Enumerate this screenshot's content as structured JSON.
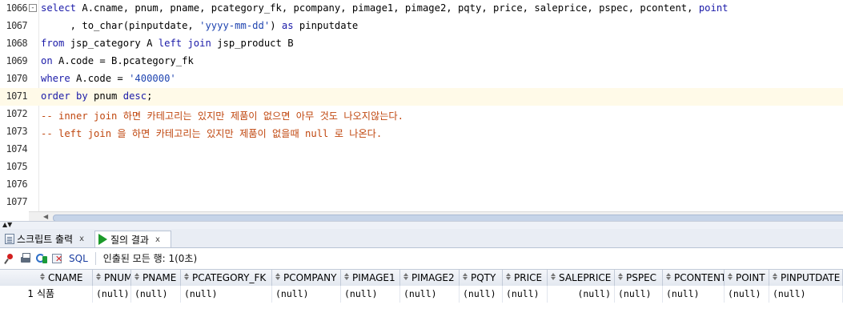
{
  "editor": {
    "lines": [
      {
        "num": "1066",
        "fold": "-",
        "segments": [
          {
            "t": "select",
            "c": "kw"
          },
          {
            "t": " A.cname, pnum, pname, pcategory_fk, pcompany, pimage1, pimage2, pqty, price, saleprice, pspec, pcontent, ",
            "c": ""
          },
          {
            "t": "point",
            "c": "kw"
          }
        ]
      },
      {
        "num": "1067",
        "segments": [
          {
            "t": "     , to_char(pinputdate, ",
            "c": ""
          },
          {
            "t": "'yyyy-mm-dd'",
            "c": "str"
          },
          {
            "t": ") ",
            "c": ""
          },
          {
            "t": "as",
            "c": "kw"
          },
          {
            "t": " pinputdate",
            "c": ""
          }
        ]
      },
      {
        "num": "1068",
        "segments": [
          {
            "t": "from",
            "c": "kw"
          },
          {
            "t": " jsp_category A ",
            "c": ""
          },
          {
            "t": "left join",
            "c": "kw"
          },
          {
            "t": " jsp_product B",
            "c": ""
          }
        ]
      },
      {
        "num": "1069",
        "segments": [
          {
            "t": "on",
            "c": "kw"
          },
          {
            "t": " A.code = B.pcategory_fk",
            "c": ""
          }
        ]
      },
      {
        "num": "1070",
        "segments": [
          {
            "t": "where",
            "c": "kw"
          },
          {
            "t": " A.code = ",
            "c": ""
          },
          {
            "t": "'400000'",
            "c": "str"
          }
        ]
      },
      {
        "num": "1071",
        "highlight": true,
        "segments": [
          {
            "t": "order by",
            "c": "kw"
          },
          {
            "t": " pnum ",
            "c": ""
          },
          {
            "t": "desc",
            "c": "kw"
          },
          {
            "t": ";",
            "c": ""
          }
        ]
      },
      {
        "num": "1072",
        "segments": [
          {
            "t": "-- inner join 하면 카테고리는 있지만 제품이 없으면 아무 것도 나오지않는다.",
            "c": "cm"
          }
        ]
      },
      {
        "num": "1073",
        "segments": [
          {
            "t": "-- left join 을 하면 카테고리는 있지만 제품이 없을때 null 로 나온다.",
            "c": "cm"
          }
        ]
      },
      {
        "num": "1074",
        "segments": []
      },
      {
        "num": "1075",
        "segments": []
      },
      {
        "num": "1076",
        "segments": []
      },
      {
        "num": "1077",
        "segments": []
      }
    ]
  },
  "tabs": {
    "script_output": "스크립트 출력",
    "query_result": "질의 결과",
    "close": "x"
  },
  "toolbar": {
    "sql_label": "SQL",
    "status": "인출된 모든 행: 1(0초)"
  },
  "grid": {
    "columns": [
      "CNAME",
      "PNUM",
      "PNAME",
      "PCATEGORY_FK",
      "PCOMPANY",
      "PIMAGE1",
      "PIMAGE2",
      "PQTY",
      "PRICE",
      "SALEPRICE",
      "PSPEC",
      "PCONTENT",
      "POINT",
      "PINPUTDATE"
    ],
    "rows": [
      {
        "num": "1",
        "cells": [
          "식품",
          "(null)",
          "(null)",
          "(null)",
          "(null)",
          "(null)",
          "(null)",
          "(null)",
          "(null)",
          "(null)",
          "(null)",
          "(null)",
          "(null)",
          "(null)"
        ]
      }
    ]
  }
}
